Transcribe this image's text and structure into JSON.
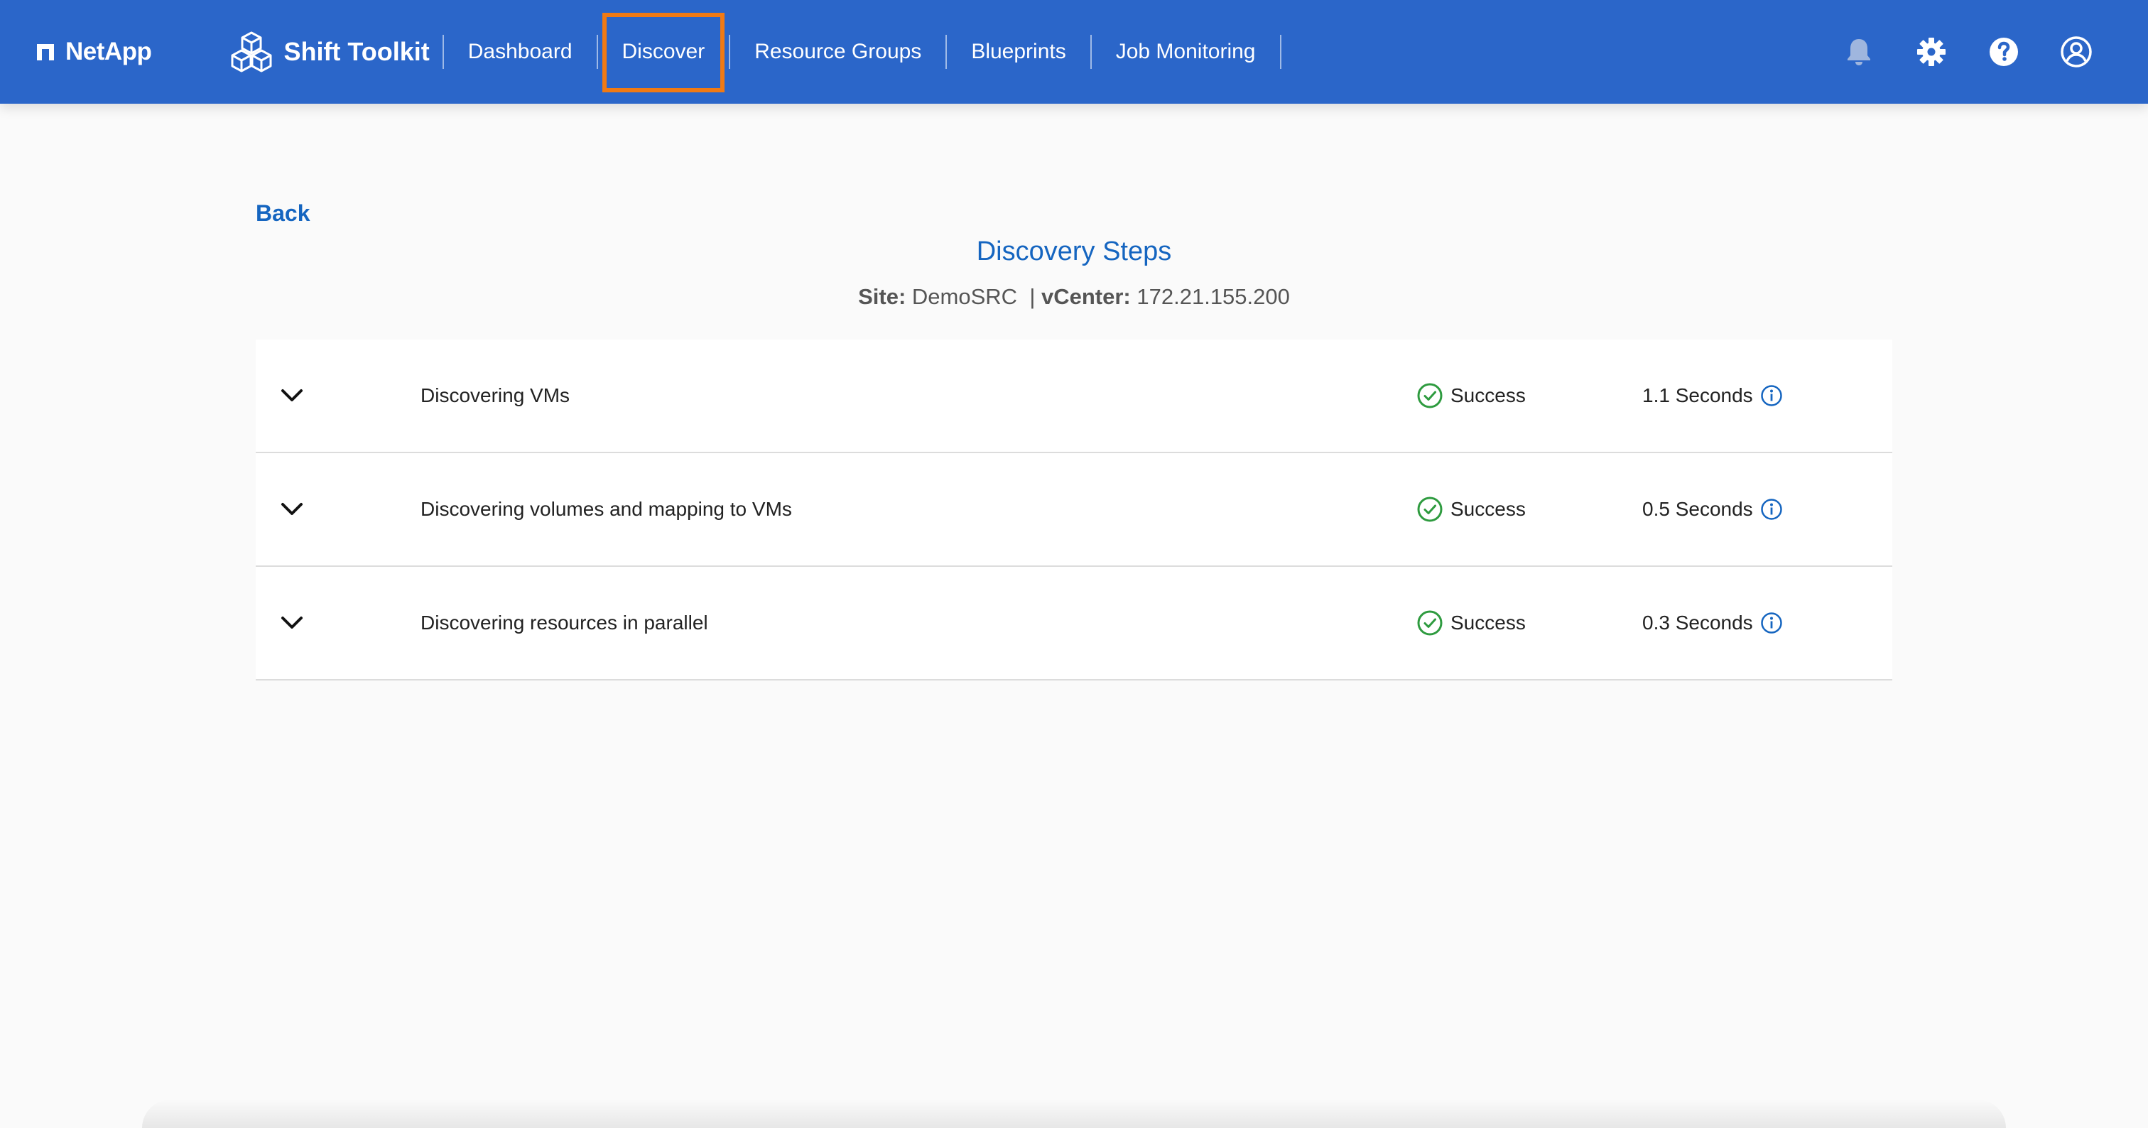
{
  "header": {
    "brand": "NetApp",
    "product": "Shift Toolkit",
    "nav": [
      {
        "label": "Dashboard",
        "active": false
      },
      {
        "label": "Discover",
        "active": true
      },
      {
        "label": "Resource Groups",
        "active": false
      },
      {
        "label": "Blueprints",
        "active": false
      },
      {
        "label": "Job Monitoring",
        "active": false
      }
    ],
    "icons": [
      "bell-icon",
      "gear-icon",
      "help-icon",
      "user-icon"
    ]
  },
  "page": {
    "back_label": "Back",
    "title": "Discovery Steps",
    "site_label": "Site:",
    "site_value": "DemoSRC",
    "separator": "|",
    "vcenter_label": "vCenter:",
    "vcenter_value": "172.21.155.200"
  },
  "steps": [
    {
      "name": "Discovering VMs",
      "status": "Success",
      "duration": "1.1 Seconds"
    },
    {
      "name": "Discovering volumes and mapping to VMs",
      "status": "Success",
      "duration": "0.5 Seconds"
    },
    {
      "name": "Discovering resources in parallel",
      "status": "Success",
      "duration": "0.3 Seconds"
    }
  ],
  "colors": {
    "header_bg": "#2b66c9",
    "active_outline": "#f07a14",
    "link_blue": "#1565c0",
    "success_green": "#2e9b3f"
  }
}
